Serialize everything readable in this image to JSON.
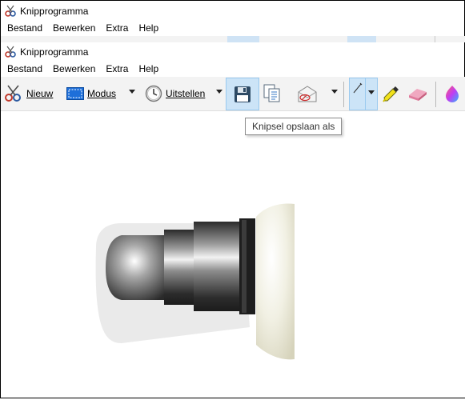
{
  "window": {
    "title": "Knipprogramma"
  },
  "menu": {
    "items": [
      "Bestand",
      "Bewerken",
      "Extra",
      "Help"
    ]
  },
  "toolbar": {
    "new_label": "Nieuw",
    "mode_label": "Modus",
    "delay_label": "Uitstellen",
    "save_icon": "floppy-disk-icon",
    "copy_icon": "copy-icon",
    "send_icon": "envelope-icon",
    "pen_icon": "pen-icon",
    "highlighter_icon": "highlighter-icon",
    "eraser_icon": "eraser-icon",
    "paint3d_icon": "paint3d-icon"
  },
  "tooltip": {
    "text": "Knipsel opslaan als"
  },
  "colors": {
    "selected": "#cce4f7",
    "selected_border": "#99c9ef",
    "toolbar_bg": "#f3f3f3"
  }
}
